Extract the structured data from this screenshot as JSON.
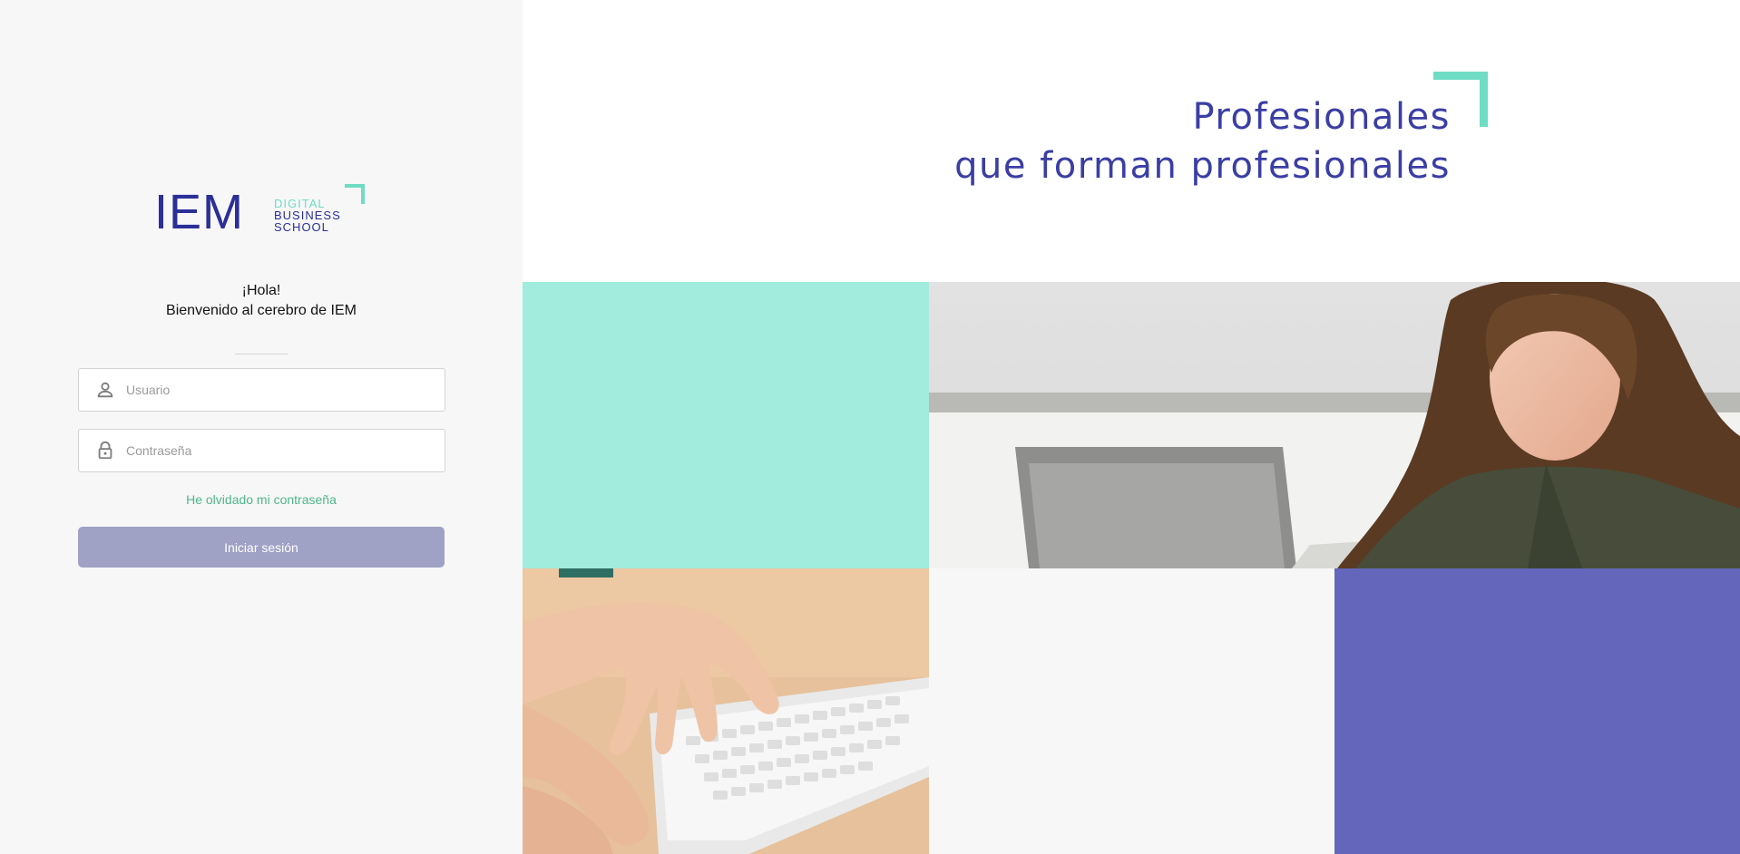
{
  "logo": {
    "main": "IEM",
    "line1": "DIGITAL",
    "line2": "BUSINESS",
    "line3": "SCHOOL"
  },
  "login": {
    "greeting": "¡Hola!",
    "welcome": "Bienvenido al cerebro de IEM",
    "username_placeholder": "Usuario",
    "password_placeholder": "Contraseña",
    "forgot_password": "He olvidado mi contraseña",
    "submit_label": "Iniciar sesión"
  },
  "hero": {
    "line1": "Profesionales",
    "line2": "que forman profesionales"
  },
  "colors": {
    "brand_blue": "#3b3ea4",
    "mint": "#a1ecdc",
    "accent_mint": "#6fdcc5",
    "purple": "#6366bb",
    "link_green": "#4fb58c",
    "button_disabled": "#9fa1c5"
  },
  "icons": {
    "user": "user-icon",
    "password": "lock-icon"
  }
}
